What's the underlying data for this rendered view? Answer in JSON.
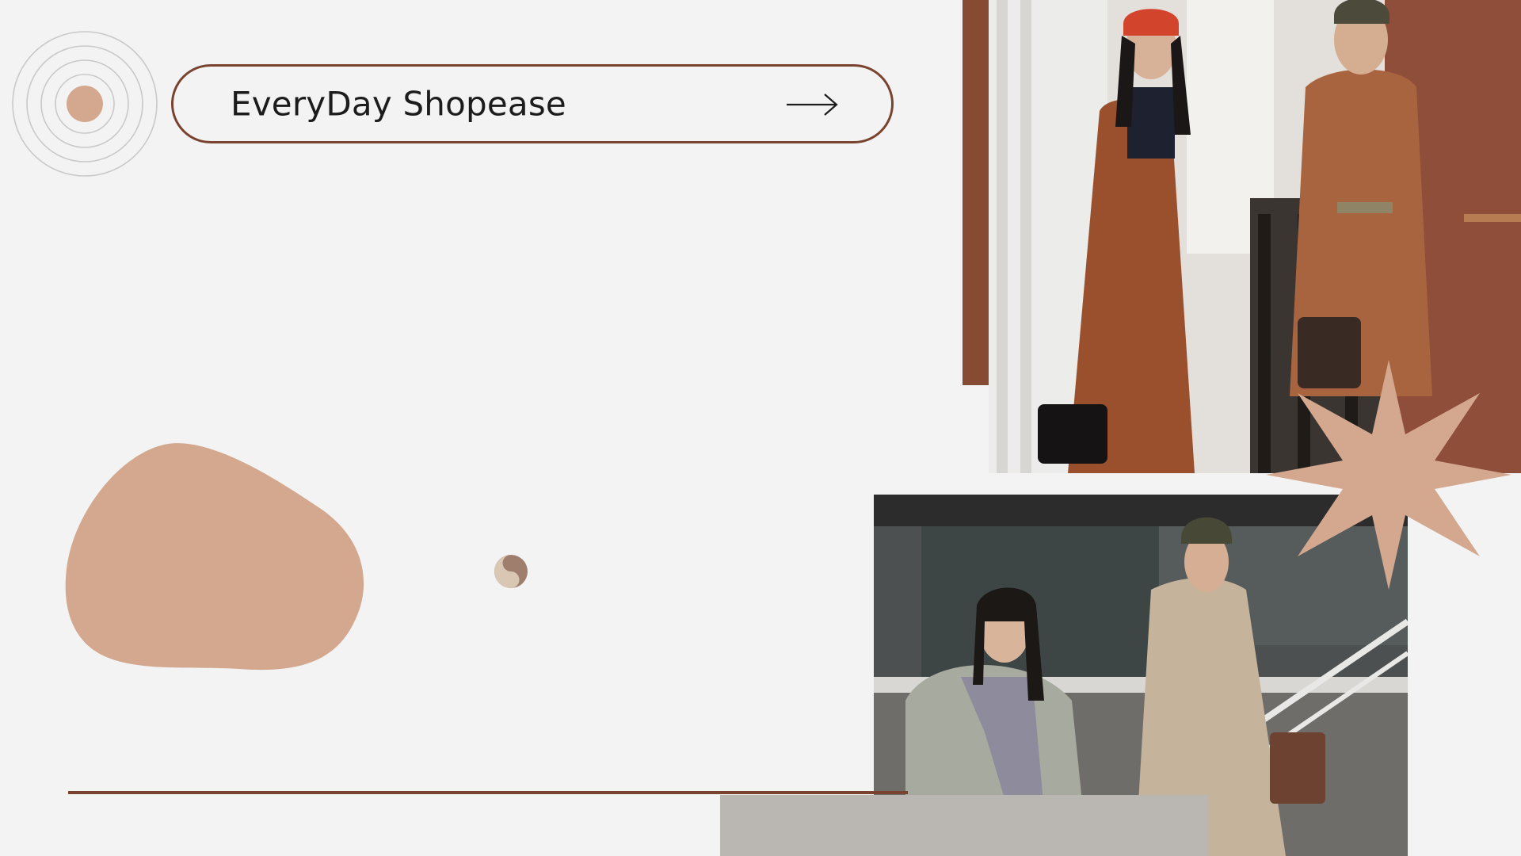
{
  "title": {
    "text": "EveryDay Shopease"
  },
  "colors": {
    "background": "#f3f3f3",
    "accent_brown": "#874a33",
    "outline_brown": "#7a4330",
    "tan": "#d4a88f",
    "gray_block": "#bab7b3",
    "ring_gray": "#c9c9c9"
  },
  "icons": {
    "arrow": "arrow-right-icon",
    "rings": "concentric-rings-icon",
    "swirl": "swirl-icon",
    "star": "eight-point-star-icon"
  },
  "photos": [
    {
      "name": "photo-two-women-brown-coats"
    },
    {
      "name": "photo-two-women-winter-parkas"
    }
  ]
}
